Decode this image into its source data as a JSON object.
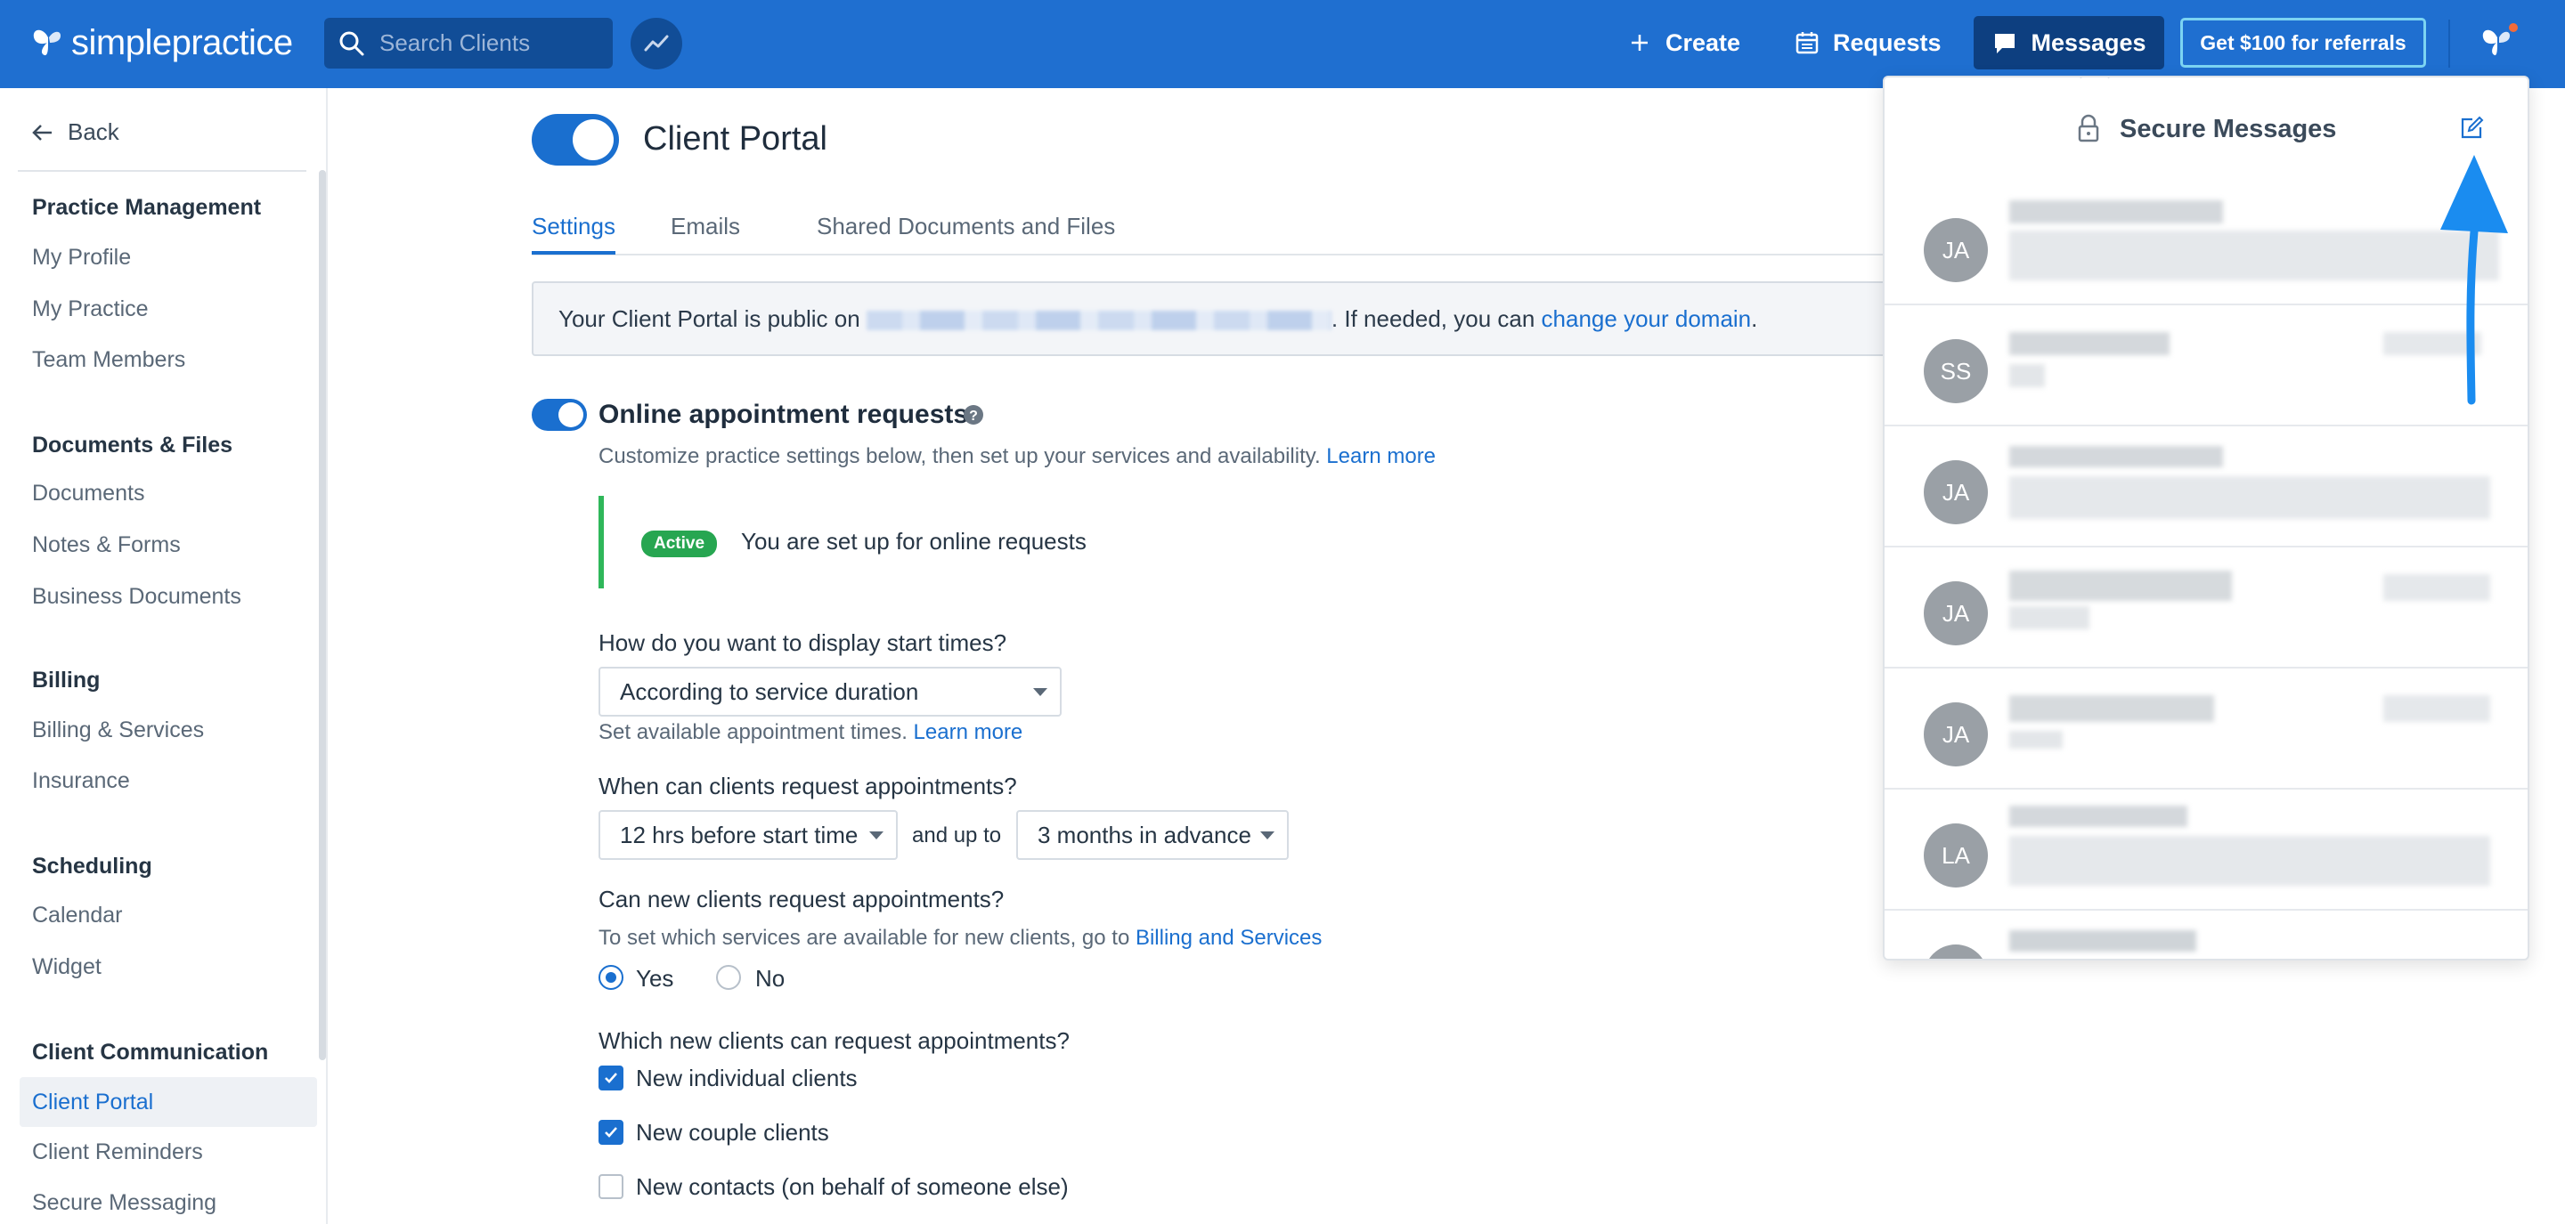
{
  "topbar": {
    "logo_text": "simplepractice",
    "search_placeholder": "Search Clients",
    "create_label": "Create",
    "requests_label": "Requests",
    "messages_label": "Messages",
    "referrals_label": "Get $100 for referrals"
  },
  "sidebar": {
    "back_label": "Back",
    "sections": [
      {
        "heading": "Practice Management",
        "items": [
          "My Profile",
          "My Practice",
          "Team Members"
        ]
      },
      {
        "heading": "Documents & Files",
        "items": [
          "Documents",
          "Notes & Forms",
          "Business Documents"
        ]
      },
      {
        "heading": "Billing",
        "items": [
          "Billing & Services",
          "Insurance"
        ]
      },
      {
        "heading": "Scheduling",
        "items": [
          "Calendar",
          "Widget"
        ]
      },
      {
        "heading": "Client Communication",
        "items": [
          "Client Portal",
          "Client Reminders",
          "Secure Messaging"
        ]
      }
    ],
    "active_item": "Client Portal"
  },
  "main": {
    "page_title": "Client Portal",
    "portal_enabled": true,
    "tabs": [
      "Settings",
      "Emails",
      "Shared Documents and Files"
    ],
    "active_tab": "Settings",
    "info": {
      "prefix": "Your Client Portal is public on",
      "middle": ". If needed, you can",
      "link": "change your domain",
      "suffix": "."
    },
    "online_requests": {
      "enabled": true,
      "title": "Online appointment requests",
      "description": "Customize practice settings below, then set up your services and availability.",
      "learn_more": "Learn more",
      "badge": "Active",
      "status_text": "You are set up for online requests"
    },
    "start_times": {
      "question": "How do you want to display start times?",
      "value": "According to service duration",
      "help": "Set available appointment times.",
      "help_link": "Learn more"
    },
    "request_window": {
      "question": "When can clients request appointments?",
      "from_value": "12 hrs before start time",
      "connector": "and up to",
      "to_value": "3 months in advance"
    },
    "new_clients": {
      "question": "Can new clients request appointments?",
      "help": "To set which services are available for new clients, go to",
      "help_link": "Billing and Services",
      "options": [
        "Yes",
        "No"
      ],
      "selected": "Yes"
    },
    "which_clients": {
      "question": "Which new clients can request appointments?",
      "options": [
        {
          "label": "New individual clients",
          "checked": true
        },
        {
          "label": "New couple clients",
          "checked": true
        },
        {
          "label": "New contacts (on behalf of someone else)",
          "checked": false
        }
      ]
    }
  },
  "messages_panel": {
    "title": "Secure Messages",
    "conversations": [
      {
        "initials": "JA"
      },
      {
        "initials": "SS"
      },
      {
        "initials": "JA"
      },
      {
        "initials": "JA"
      },
      {
        "initials": "JA"
      },
      {
        "initials": "LA"
      },
      {
        "initials": ""
      }
    ]
  },
  "colors": {
    "brand_blue": "#1f6fd0",
    "link_blue": "#1a6fcf",
    "active_green": "#27a651",
    "annotation_arrow": "#1a8cf0"
  }
}
